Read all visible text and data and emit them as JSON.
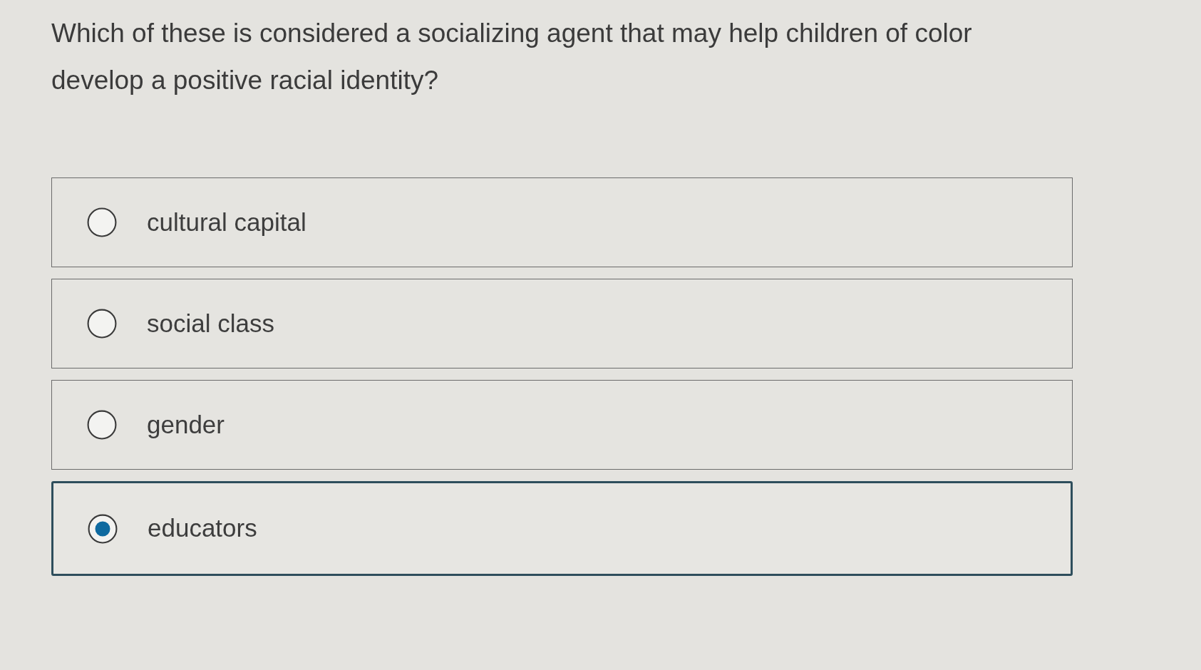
{
  "question": "Which of these is considered a socializing agent that may help children of color develop a positive racial identity?",
  "options": [
    {
      "label": "cultural capital",
      "selected": false
    },
    {
      "label": "social class",
      "selected": false
    },
    {
      "label": "gender",
      "selected": false
    },
    {
      "label": "educators",
      "selected": true
    }
  ]
}
